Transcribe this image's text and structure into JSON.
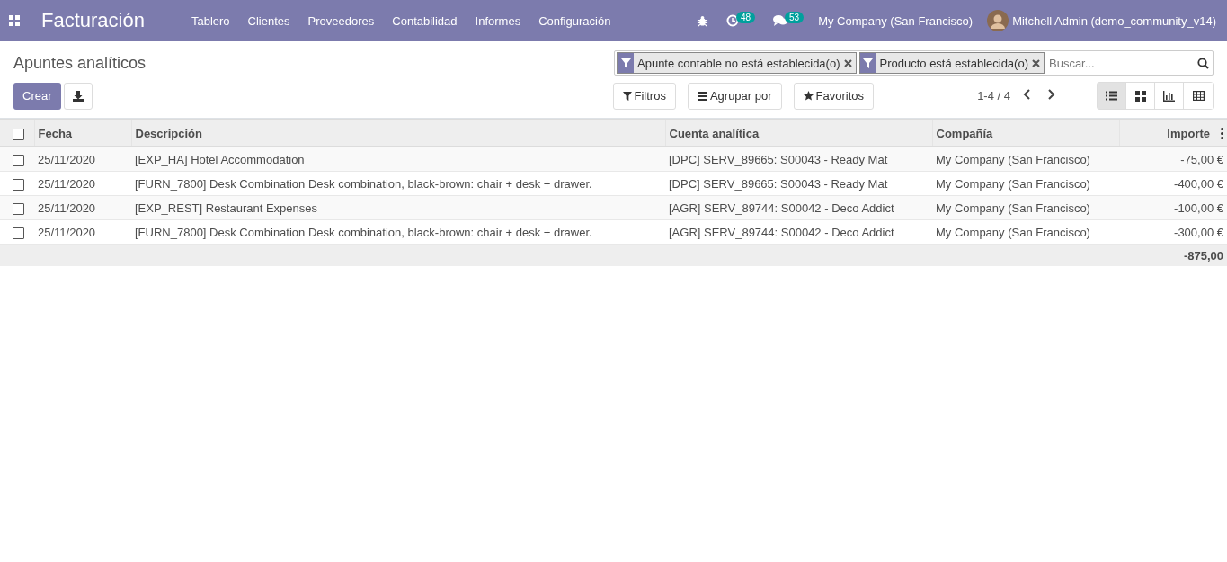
{
  "navbar": {
    "app_title": "Facturación",
    "menu": [
      "Tablero",
      "Clientes",
      "Proveedores",
      "Contabilidad",
      "Informes",
      "Configuración"
    ],
    "activity_count": "48",
    "message_count": "53",
    "company": "My Company (San Francisco)",
    "user": "Mitchell Admin (demo_community_v14)"
  },
  "control_panel": {
    "breadcrumb": "Apuntes analíticos",
    "create_button": "Crear",
    "facets": [
      {
        "label": "Apunte contable no está establecida(o)"
      },
      {
        "label": "Producto está establecida(o)"
      }
    ],
    "search": {
      "placeholder": "Buscar..."
    },
    "filter_buttons": [
      {
        "kind": "filter",
        "label": "Filtros"
      },
      {
        "kind": "group",
        "label": "Agrupar por"
      },
      {
        "kind": "favorite",
        "label": "Favoritos"
      }
    ],
    "pager": "1-4 / 4",
    "views": [
      {
        "kind": "list",
        "selected": true
      },
      {
        "kind": "kanban",
        "selected": false
      },
      {
        "kind": "graph",
        "selected": false
      },
      {
        "kind": "pivot",
        "selected": false
      }
    ]
  },
  "table": {
    "columns": [
      "Fecha",
      "Descripción",
      "Cuenta analítica",
      "Compañía",
      "Importe"
    ],
    "select_all_checked": false,
    "rows": [
      {
        "checked": false,
        "cells": [
          "25/11/2020",
          "[EXP_HA] Hotel Accommodation",
          "[DPC] SERV_89665: S00043 - Ready Mat",
          "My Company (San Francisco)",
          "-75,00 €"
        ]
      },
      {
        "checked": false,
        "cells": [
          "25/11/2020",
          "[FURN_7800] Desk Combination Desk combination, black-brown: chair + desk + drawer.",
          "[DPC] SERV_89665: S00043 - Ready Mat",
          "My Company (San Francisco)",
          "-400,00 €"
        ]
      },
      {
        "checked": false,
        "cells": [
          "25/11/2020",
          "[EXP_REST] Restaurant Expenses",
          "[AGR] SERV_89744: S00042 - Deco Addict",
          "My Company (San Francisco)",
          "-100,00 €"
        ]
      },
      {
        "checked": false,
        "cells": [
          "25/11/2020",
          "[FURN_7800] Desk Combination Desk combination, black-brown: chair + desk + drawer.",
          "[AGR] SERV_89744: S00042 - Deco Addict",
          "My Company (San Francisco)",
          "-300,00 €"
        ]
      }
    ],
    "total": "-875,00"
  }
}
